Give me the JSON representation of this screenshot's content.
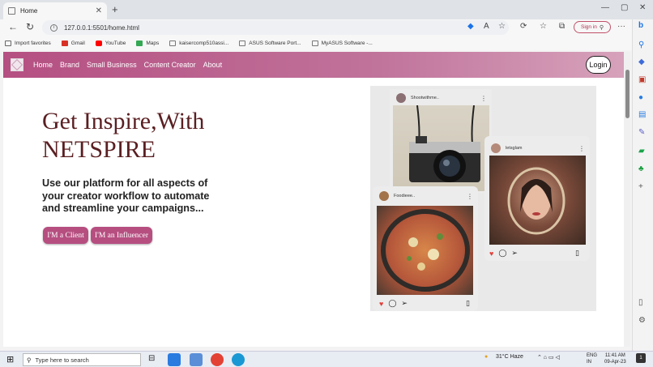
{
  "browser": {
    "tab_title": "Home",
    "url": "127.0.0.1:5501/home.html",
    "sign_in_label": "Sign in",
    "bookmarks": [
      {
        "label": "Import favorites",
        "color": "#666"
      },
      {
        "label": "Gmail",
        "color": "#d93025"
      },
      {
        "label": "YouTube",
        "color": "#ff0000"
      },
      {
        "label": "Maps",
        "color": "#34a853"
      },
      {
        "label": "kaisercomp510assi...",
        "color": "#777"
      },
      {
        "label": "ASUS Software Port...",
        "color": "#777"
      },
      {
        "label": "MyASUS Software -...",
        "color": "#777"
      }
    ]
  },
  "site": {
    "nav": [
      "Home",
      "Brand",
      "Small Business",
      "Content Creator",
      "About"
    ],
    "login_label": "Login",
    "hero_title_line1": "Get Inspire,With",
    "hero_title_line2": "NETSPIRE",
    "hero_subtitle": "Use our platform for all aspects of your creator workflow to automate and streamline your campaigns...",
    "client_button": "I'M a Client",
    "influencer_button": "I'M an Influencer"
  },
  "posts": [
    {
      "user": "Shootwithme..",
      "photo": "camera"
    },
    {
      "user": "letsglam",
      "photo": "portrait"
    },
    {
      "user": "Foodieee..",
      "photo": "food"
    }
  ],
  "taskbar": {
    "search_placeholder": "Type here to search",
    "weather": "31°C Haze",
    "lang_line1": "ENG",
    "lang_line2": "IN",
    "time": "11:41 AM",
    "date": "09-Apr-23",
    "notif_count": "1"
  },
  "colors": {
    "brand": "#b64e80",
    "title": "#5a1f22",
    "heart": "#e0413c"
  }
}
